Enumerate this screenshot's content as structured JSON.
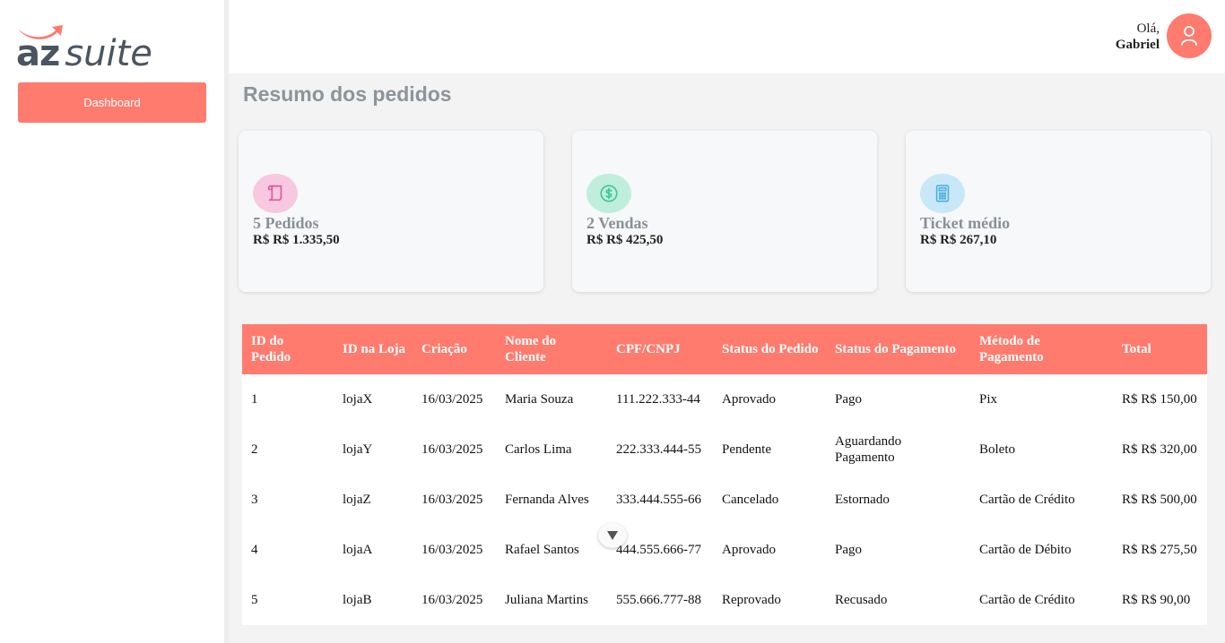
{
  "brand": {
    "az": "az",
    "suite": "suite",
    "swoosh_color": "#fe7b6e",
    "text_color": "#4a5560"
  },
  "sidebar": {
    "items": [
      {
        "label": "Dashboard",
        "active": true
      }
    ]
  },
  "header": {
    "greeting": "Olá,",
    "user_name": "Gabriel",
    "avatar_icon": "user-icon"
  },
  "page": {
    "title": "Resumo dos pedidos"
  },
  "cards": [
    {
      "icon": "scroll-icon",
      "icon_bg": "#f7c8e0",
      "icon_color": "#e0579e",
      "label": "5 Pedidos",
      "value": "R$ R$ 1.335,50"
    },
    {
      "icon": "dollar-icon",
      "icon_bg": "#bfeedd",
      "icon_color": "#3fc59a",
      "label": "2 Vendas",
      "value": "R$ R$ 425,50"
    },
    {
      "icon": "calculator-icon",
      "icon_bg": "#c8e8f7",
      "icon_color": "#4aaee0",
      "label": "Ticket médio",
      "value": "R$ R$ 267,10"
    }
  ],
  "table": {
    "headers": [
      "ID do Pedido",
      "ID na Loja",
      "Criação",
      "Nome do Cliente",
      "CPF/CNPJ",
      "Status do Pedido",
      "Status do Pagamento",
      "Método de Pagamento",
      "Total"
    ],
    "rows": [
      [
        "1",
        "lojaX",
        "16/03/2025",
        "Maria Souza",
        "111.222.333-44",
        "Aprovado",
        "Pago",
        "Pix",
        "R$ R$ 150,00"
      ],
      [
        "2",
        "lojaY",
        "16/03/2025",
        "Carlos Lima",
        "222.333.444-55",
        "Pendente",
        "Aguardando Pagamento",
        "Boleto",
        "R$ R$ 320,00"
      ],
      [
        "3",
        "lojaZ",
        "16/03/2025",
        "Fernanda Alves",
        "333.444.555-66",
        "Cancelado",
        "Estornado",
        "Cartão de Crédito",
        "R$ R$ 500,00"
      ],
      [
        "4",
        "lojaA",
        "16/03/2025",
        "Rafael Santos",
        "444.555.666-77",
        "Aprovado",
        "Pago",
        "Cartão de Débito",
        "R$ R$ 275,50"
      ],
      [
        "5",
        "lojaB",
        "16/03/2025",
        "Juliana Martins",
        "555.666.777-88",
        "Reprovado",
        "Recusado",
        "Cartão de Crédito",
        "R$ R$ 90,00"
      ]
    ]
  },
  "colors": {
    "accent": "#fe7b6e",
    "title_gray": "#8c949c"
  }
}
